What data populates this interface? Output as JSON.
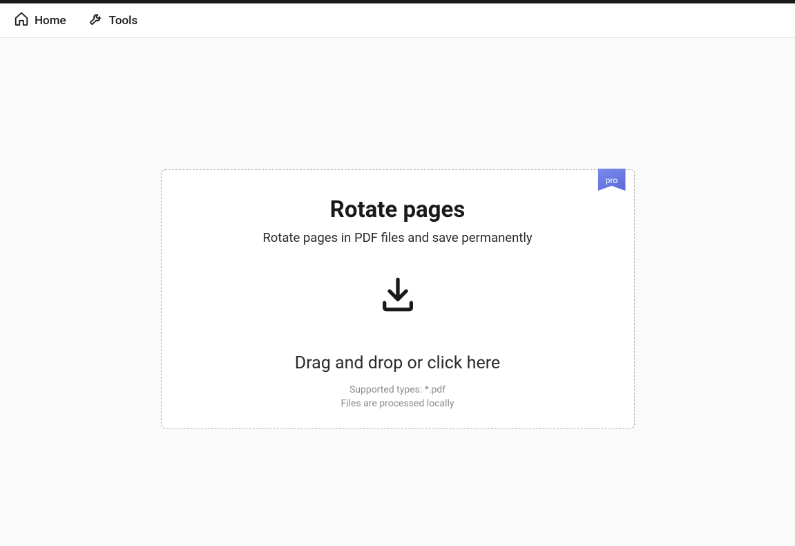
{
  "nav": {
    "home": "Home",
    "tools": "Tools"
  },
  "main": {
    "badge": "pro",
    "title": "Rotate pages",
    "subtitle": "Rotate pages in PDF files and save permanently",
    "drag_prompt": "Drag and drop or click here",
    "supported_types": "Supported types: *.pdf",
    "processed_locally": "Files are processed locally"
  }
}
